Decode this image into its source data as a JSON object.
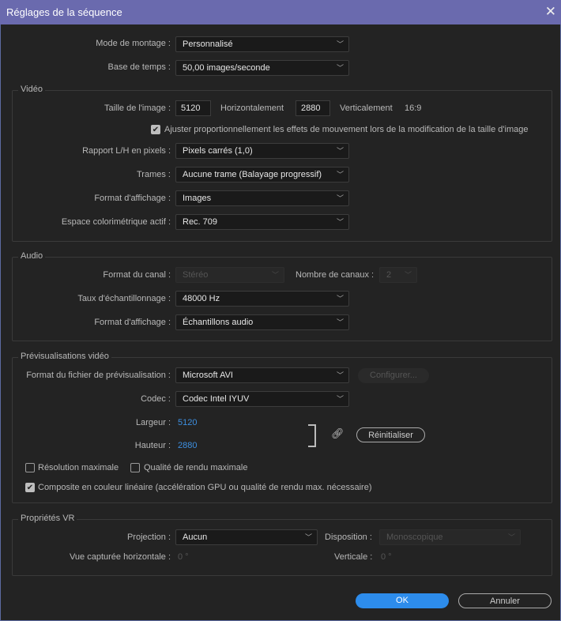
{
  "title": "Réglages de la séquence",
  "top": {
    "mode_label": "Mode de montage :",
    "mode_value": "Personnalisé",
    "base_label": "Base de temps :",
    "base_value": "50,00  images/seconde"
  },
  "video": {
    "group": "Vidéo",
    "size_label": "Taille de l'image :",
    "width": "5120",
    "horiz": "Horizontalement",
    "height": "2880",
    "vert": "Verticalement",
    "ratio": "16:9",
    "scale_check": "Ajuster proportionnellement les effets de mouvement lors de la modification de la taille d'image",
    "scale_checked": true,
    "pixel_label": "Rapport L/H en pixels :",
    "pixel_value": "Pixels carrés (1,0)",
    "fields_label": "Trames :",
    "fields_value": "Aucune trame (Balayage progressif)",
    "display_label": "Format d'affichage :",
    "display_value": "Images",
    "color_label": "Espace colorimétrique actif :",
    "color_value": "Rec. 709"
  },
  "audio": {
    "group": "Audio",
    "channel_label": "Format du canal :",
    "channel_value": "Stéréo",
    "count_label": "Nombre de canaux :",
    "count_value": "2",
    "rate_label": "Taux d'échantillonnage :",
    "rate_value": "48000 Hz",
    "display_label": "Format d'affichage :",
    "display_value": "Échantillons audio"
  },
  "preview": {
    "group": "Prévisualisations vidéo",
    "format_label": "Format du fichier de prévisualisation :",
    "format_value": "Microsoft AVI",
    "configure": "Configurer...",
    "codec_label": "Codec :",
    "codec_value": "Codec Intel IYUV",
    "width_label": "Largeur :",
    "width": "5120",
    "height_label": "Hauteur :",
    "height": "2880",
    "reset": "Réinitialiser",
    "maxres": "Résolution maximale",
    "maxres_checked": false,
    "maxquality": "Qualité de rendu maximale",
    "maxquality_checked": false,
    "linear": "Composite en couleur linéaire (accélération GPU ou qualité de rendu max. nécessaire)",
    "linear_checked": true
  },
  "vr": {
    "group": "Propriétés VR",
    "projection_label": "Projection :",
    "projection_value": "Aucun",
    "layout_label": "Disposition :",
    "layout_value": "Monoscopique",
    "hview_label": "Vue capturée horizontale :",
    "hview": "0 °",
    "vview_label": "Verticale :",
    "vview": "0 °"
  },
  "buttons": {
    "ok": "OK",
    "cancel": "Annuler"
  },
  "colors": {
    "titlebar": "#6a6aae",
    "accent": "#2d8ceb",
    "bg": "#232323"
  }
}
